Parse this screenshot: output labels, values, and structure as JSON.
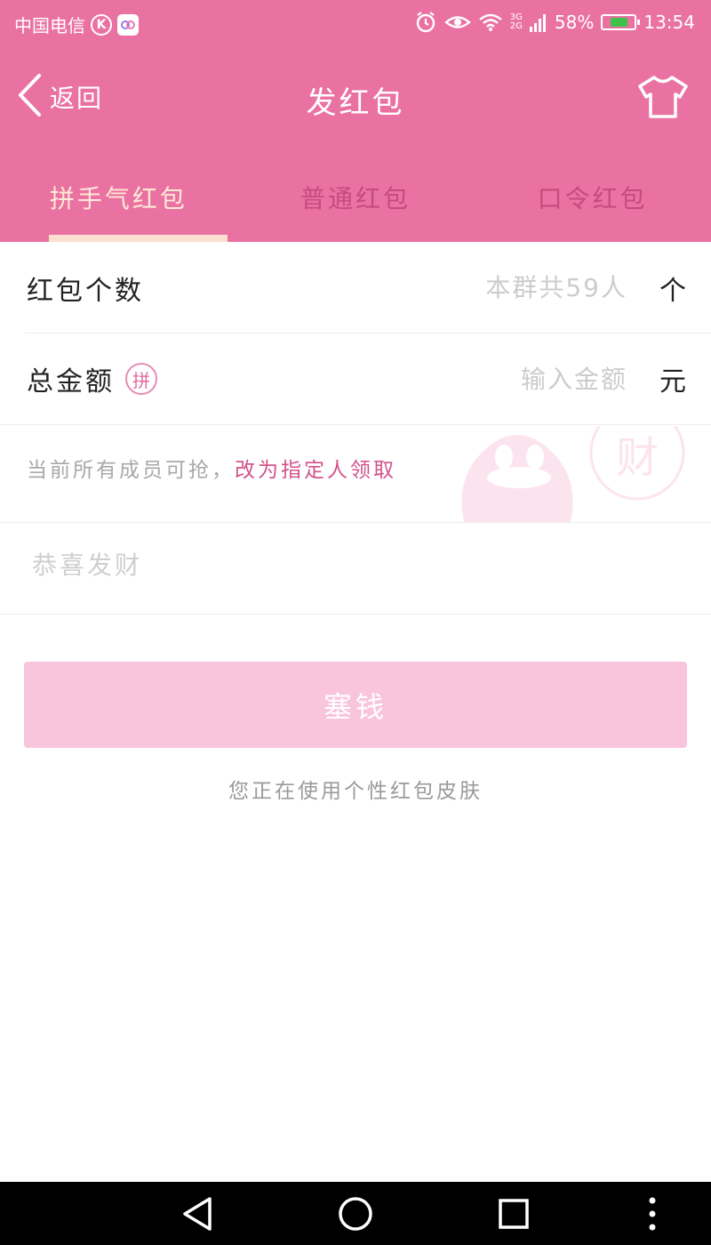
{
  "status_bar": {
    "carrier": "中国电信",
    "network_label_top": "3G",
    "network_label_bottom": "2G",
    "battery": "58%",
    "battery_level": 0.58,
    "time": "13:54",
    "icons": [
      "k-app-icon",
      "app-icon",
      "alarm-icon",
      "eye-icon",
      "wifi-icon",
      "signal-icon",
      "battery-icon"
    ]
  },
  "header": {
    "back_label": "返回",
    "title": "发红包",
    "shirt_icon": "shirt-icon"
  },
  "tabs": [
    {
      "label": "拼手气红包",
      "active": true
    },
    {
      "label": "普通红包",
      "active": false
    },
    {
      "label": "口令红包",
      "active": false
    }
  ],
  "form": {
    "count": {
      "label": "红包个数",
      "placeholder": "本群共59人",
      "unit": "个"
    },
    "amount": {
      "label": "总金额",
      "badge": "拼",
      "placeholder": "输入金额",
      "unit": "元"
    },
    "notice": {
      "text": "当前所有成员可抢，",
      "link": "改为指定人领取"
    },
    "greeting_placeholder": "恭喜发财",
    "submit_label": "塞钱",
    "skin_hint": "您正在使用个性红包皮肤"
  },
  "mascot_text": "财",
  "colors": {
    "header_bg": "#ea72a2",
    "active_tab": "#ffe9d6",
    "inactive_tab": "#c54b7e",
    "link": "#d2538c",
    "submit_bg": "#f9c5dc",
    "nav_bg": "#000000"
  },
  "nav_bar": [
    "back-triangle-icon",
    "home-circle-icon",
    "recents-square-icon",
    "more-dots-icon"
  ]
}
